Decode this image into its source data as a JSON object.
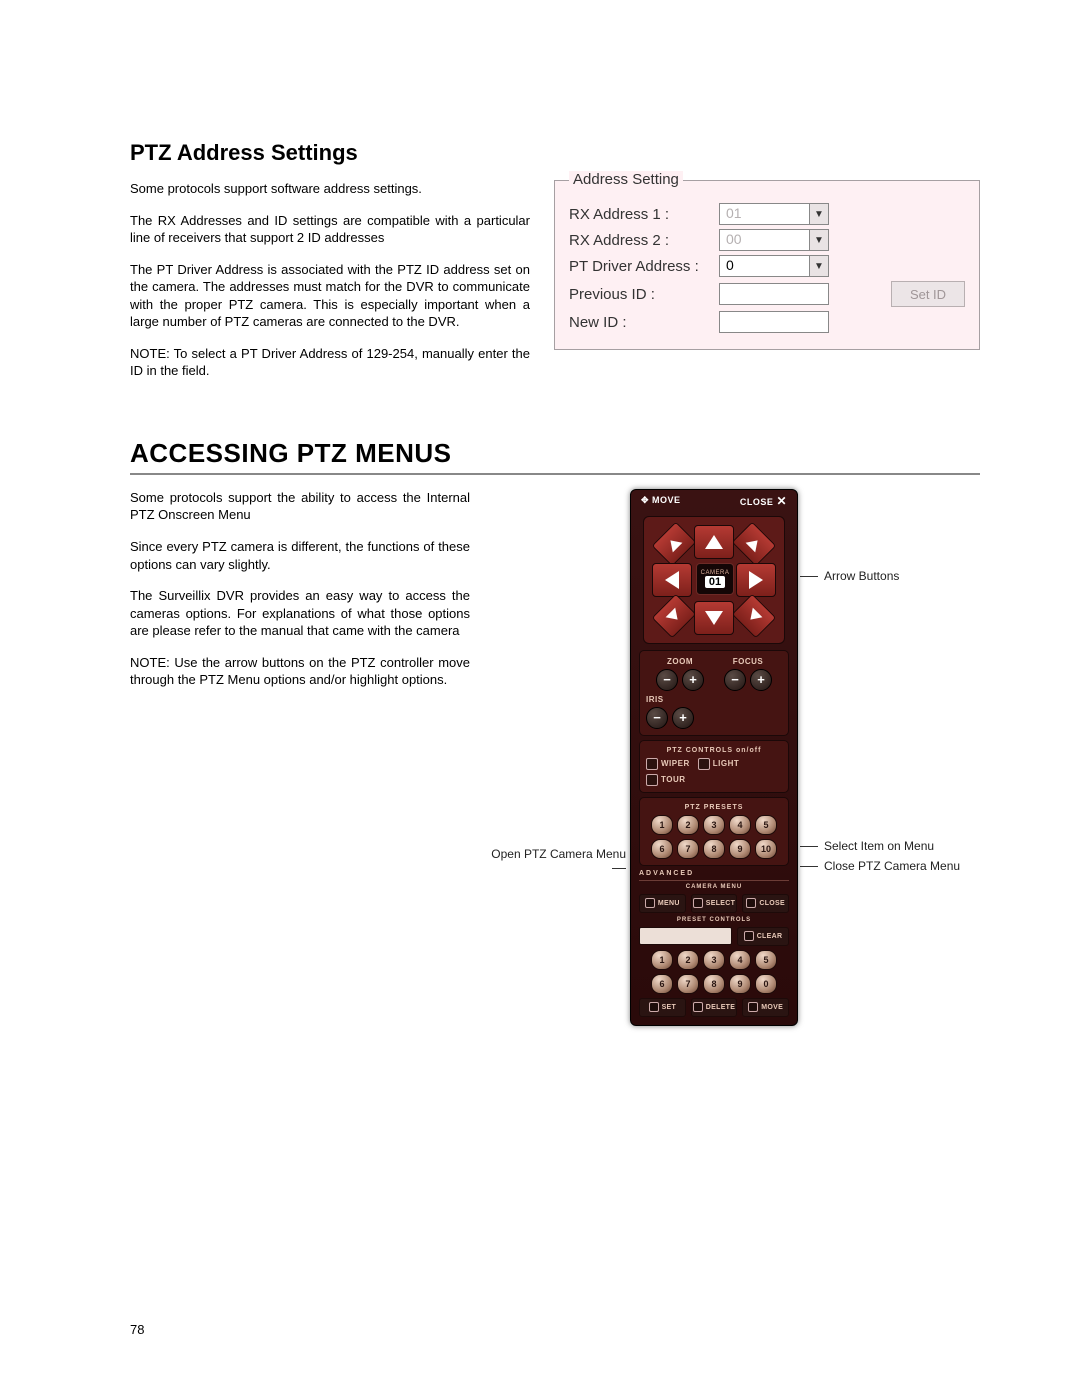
{
  "headings": {
    "ptz_address": "PTZ Address Settings",
    "accessing": "ACCESSING PTZ MENUS"
  },
  "paras1": {
    "p1": "Some protocols support software address settings.",
    "p2": "The RX Addresses and ID settings are compatible with a particular line of receivers that support 2 ID addresses",
    "p3": "The PT Driver Address is associated with the PTZ ID address set on the camera.  The addresses must match for the DVR to communicate with the proper PTZ camera.  This is especially important when a large number of PTZ cameras are connected to the DVR.",
    "p4": "NOTE: To select a PT Driver Address of 129-254, manually enter the ID in the field."
  },
  "address_panel": {
    "legend": "Address Setting",
    "rx1_label": "RX Address 1 :",
    "rx1_value": "01",
    "rx2_label": "RX Address 2 :",
    "rx2_value": "00",
    "ptdrv_label": "PT Driver Address  :",
    "ptdrv_value": "0",
    "prev_label": "Previous ID :",
    "new_label": "New ID :",
    "setid_label": "Set ID"
  },
  "paras2": {
    "p1": "Some protocols support the ability to access the Internal PTZ Onscreen Menu",
    "p2": "Since every PTZ camera is different, the functions of these options can vary slightly.",
    "p3": "The Surveillix DVR provides an easy way to access the cameras options. For explanations of what those options are please refer to the manual that came with the camera",
    "p4": "NOTE: Use the arrow buttons on the PTZ controller move through the PTZ Menu options and/or highlight options."
  },
  "callouts": {
    "arrow": "Arrow Buttons",
    "open": "Open PTZ Camera Menu",
    "select": "Select Item on Menu",
    "close": "Close PTZ Camera Menu"
  },
  "ptz": {
    "move": "MOVE",
    "close": "CLOSE",
    "camera": "CAMERA",
    "camera_value": "01",
    "zoom": "ZOOM",
    "focus": "FOCUS",
    "iris": "IRIS",
    "controls_title": "PTZ CONTROLS  on/off",
    "wiper": "WIPER",
    "light": "LIGHT",
    "tour": "TOUR",
    "presets_title": "PTZ PRESETS",
    "presets": [
      "1",
      "2",
      "3",
      "4",
      "5",
      "6",
      "7",
      "8",
      "9",
      "10"
    ],
    "advanced": "ADVANCED",
    "camera_menu": "CAMERA MENU",
    "menu": "MENU",
    "select": "SELECT",
    "closebtn": "CLOSE",
    "preset_controls": "PRESET CONTROLS",
    "clear": "CLEAR",
    "preset_nums": [
      "1",
      "2",
      "3",
      "4",
      "5",
      "6",
      "7",
      "8",
      "9",
      "0"
    ],
    "set": "SET",
    "delete": "DELETE",
    "movebtn": "MOVE"
  },
  "page_number": "78"
}
